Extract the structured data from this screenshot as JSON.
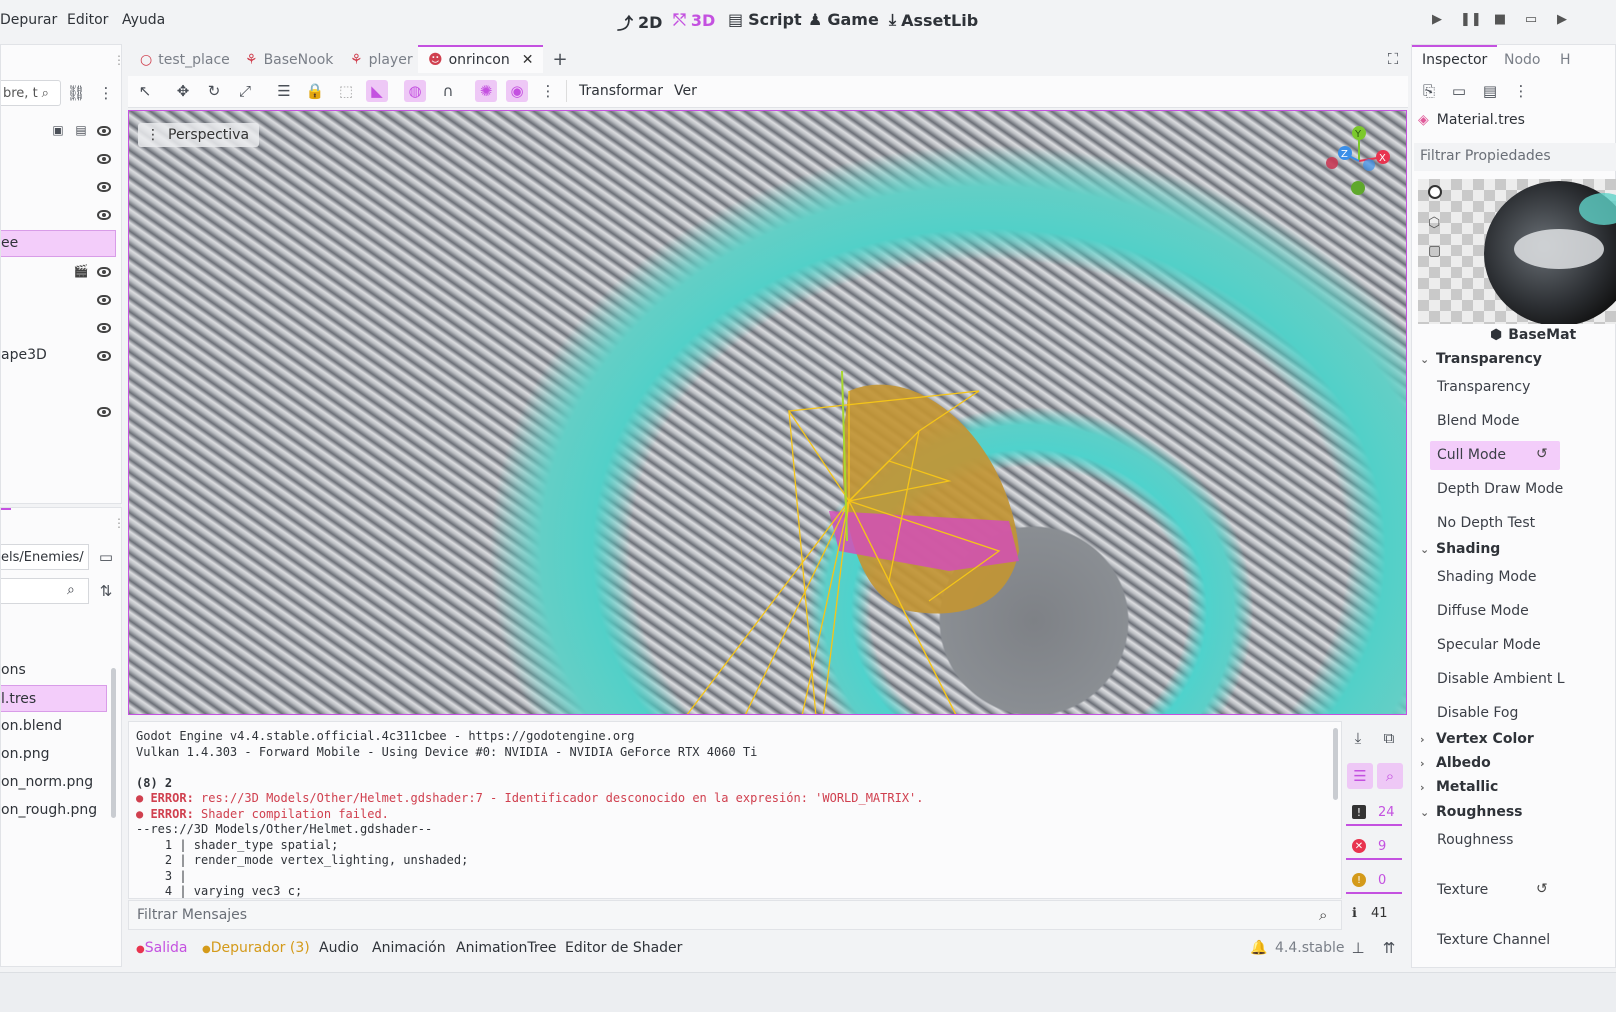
{
  "menu": {
    "items": [
      "Depurar",
      "Editor",
      "Ayuda"
    ]
  },
  "modes": {
    "m2d": "2D",
    "m3d": "3D",
    "script": "Script",
    "game": "Game",
    "assetlib": "AssetLib"
  },
  "scene_tabs": [
    {
      "label": "test_place"
    },
    {
      "label": "BaseNook"
    },
    {
      "label": "player"
    },
    {
      "label": "onrincon"
    }
  ],
  "scene_panel": {
    "filter_text": "bre, t",
    "nodes": [
      "ee",
      "ape3D"
    ]
  },
  "filesystem": {
    "path": "els/Enemies/",
    "items": [
      "ons",
      "l.tres",
      "on.blend",
      "on.png",
      "on_norm.png",
      "on_rough.png"
    ]
  },
  "viewport": {
    "menu_transform": "Transformar",
    "menu_view": "Ver",
    "perspective_label": "Perspectiva",
    "gizmo": {
      "x": "X",
      "y": "Y",
      "z": "Z"
    }
  },
  "inspector": {
    "tab_inspector": "Inspector",
    "tab_node": "Nodo",
    "tab_history": "H",
    "resource_name": "Material.tres",
    "filter_placeholder": "Filtrar Propiedades",
    "preview_label": "BaseMat",
    "sections": {
      "transparency": "Transparency",
      "shading": "Shading",
      "vertex_color": "Vertex Color",
      "albedo": "Albedo",
      "metallic": "Metallic",
      "roughness": "Roughness"
    },
    "rows": {
      "transparency": "Transparency",
      "blend_mode": "Blend Mode",
      "cull_mode": "Cull Mode",
      "depth_draw_mode": "Depth Draw Mode",
      "no_depth_test": "No Depth Test",
      "shading_mode": "Shading Mode",
      "diffuse_mode": "Diffuse Mode",
      "specular_mode": "Specular Mode",
      "disable_ambient": "Disable Ambient L",
      "disable_fog": "Disable Fog",
      "roughness": "Roughness",
      "texture": "Texture",
      "texture_channel": "Texture Channel"
    }
  },
  "console": {
    "lines": [
      "Godot Engine v4.4.stable.official.4c311cbee - https://godotengine.org",
      "Vulkan 1.4.303 - Forward Mobile - Using Device #0: NVIDIA - NVIDIA GeForce RTX 4060 Ti",
      "",
      "(8) 2"
    ],
    "error1_prefix": "ERROR:",
    "error1_text": "res://3D Models/Other/Helmet.gdshader:7 - Identificador desconocido en la expresión: 'WORLD_MATRIX'.",
    "error2_prefix": "ERROR:",
    "error2_text": "Shader compilation failed.",
    "code_header": "--res://3D Models/Other/Helmet.gdshader--",
    "code_lines": [
      "    1 | shader_type spatial;",
      "    2 | render_mode vertex_lighting, unshaded;",
      "    3 |",
      "    4 | varying vec3 c;"
    ],
    "filter_placeholder": "Filtrar Mensajes",
    "counts": {
      "messages": "24",
      "errors": "9",
      "warnings": "0",
      "info": "41"
    }
  },
  "bottom_tabs": {
    "output": "Salida",
    "debugger": "Depurador (3)",
    "audio": "Audio",
    "animation": "Animación",
    "animation_tree": "AnimationTree",
    "shader_editor": "Editor de Shader",
    "version": "4.4.stable"
  },
  "colors": {
    "accent": "#c451e0",
    "error": "#d0404f",
    "warning": "#d49a1a",
    "gizmo_x": "#e8344f",
    "gizmo_y": "#7cc92c",
    "gizmo_z": "#3a8fe8"
  }
}
